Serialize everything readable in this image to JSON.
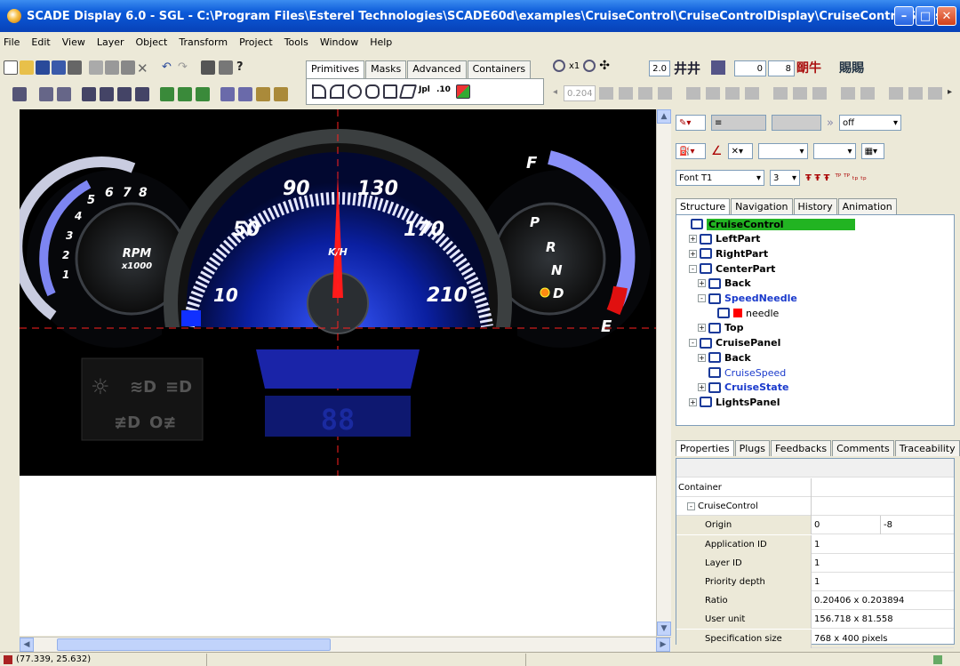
{
  "window": {
    "title": "SCADE Display 6.0 - SGL - C:\\Program Files\\Esterel Technologies\\SCADE60d\\examples\\CruiseControl\\CruiseControlDisplay\\CruiseControlSdy.sgf"
  },
  "menu": [
    "File",
    "Edit",
    "View",
    "Layer",
    "Object",
    "Transform",
    "Project",
    "Tools",
    "Window",
    "Help"
  ],
  "toolbar": {
    "palette_tabs": [
      "Primitives",
      "Masks",
      "Advanced",
      "Containers"
    ],
    "zoom_label": "x1",
    "grid_value": "2.0",
    "field_a": "0",
    "field_b": "8",
    "layer_value": "0.204"
  },
  "canvas": {
    "rpm_label": "RPM",
    "rpm_unit": "x1000",
    "rpm_ticks": [
      "1",
      "2",
      "3",
      "4",
      "5",
      "6",
      "7",
      "8"
    ],
    "speed_ticks": [
      "10",
      "50",
      "90",
      "130",
      "170",
      "210"
    ],
    "speed_unit": "K/H",
    "gears": [
      "P",
      "R",
      "N",
      "D"
    ],
    "fuel_full": "F",
    "fuel_empty": "E",
    "cruise_digits": "88"
  },
  "format": {
    "line_state": "off",
    "font": "Font T1",
    "font_size": "3"
  },
  "structure_tabs": [
    "Structure",
    "Navigation",
    "History",
    "Animation"
  ],
  "tree": [
    {
      "label": "CruiseControl",
      "depth": 0,
      "selected": true
    },
    {
      "label": "LeftPart",
      "depth": 1,
      "exp": "+"
    },
    {
      "label": "RightPart",
      "depth": 1,
      "exp": "+"
    },
    {
      "label": "CenterPart",
      "depth": 1,
      "exp": "-"
    },
    {
      "label": "Back",
      "depth": 2,
      "exp": "+"
    },
    {
      "label": "SpeedNeedle",
      "depth": 2,
      "exp": "-",
      "blue": true
    },
    {
      "label": "needle",
      "depth": 3,
      "normal": true,
      "swatch": "#ff0000"
    },
    {
      "label": "Top",
      "depth": 2,
      "exp": "+"
    },
    {
      "label": "CruisePanel",
      "depth": 1,
      "exp": "-"
    },
    {
      "label": "Back",
      "depth": 2,
      "exp": "+"
    },
    {
      "label": "CruiseSpeed",
      "depth": 2,
      "blue": true,
      "normal": true
    },
    {
      "label": "CruiseState",
      "depth": 2,
      "exp": "+",
      "blue": true
    },
    {
      "label": "LightsPanel",
      "depth": 1,
      "exp": "+"
    }
  ],
  "prop_tabs": [
    "Properties",
    "Plugs",
    "Feedbacks",
    "Comments",
    "Traceability"
  ],
  "properties": [
    {
      "key": "Container",
      "v1": "",
      "v2": "",
      "depth": 0
    },
    {
      "key": "CruiseControl",
      "v1": "",
      "v2": "",
      "depth": 1
    },
    {
      "key": "Origin",
      "v1": "0",
      "v2": "-8",
      "depth": 2
    },
    {
      "key": "Application ID",
      "v1": "1",
      "v2": "",
      "depth": 2
    },
    {
      "key": "Layer ID",
      "v1": "1",
      "v2": "",
      "depth": 2
    },
    {
      "key": "Priority depth",
      "v1": "1",
      "v2": "",
      "depth": 2
    },
    {
      "key": "Ratio",
      "v1": "0.20406 x 0.203894",
      "v2": "",
      "depth": 2
    },
    {
      "key": "User unit",
      "v1": "156.718 x 81.558",
      "v2": "",
      "depth": 2
    },
    {
      "key": "Specification size",
      "v1": "768 x 400 pixels",
      "v2": "",
      "depth": 2
    }
  ],
  "status": {
    "coords": "(77.339, 25.632)"
  }
}
